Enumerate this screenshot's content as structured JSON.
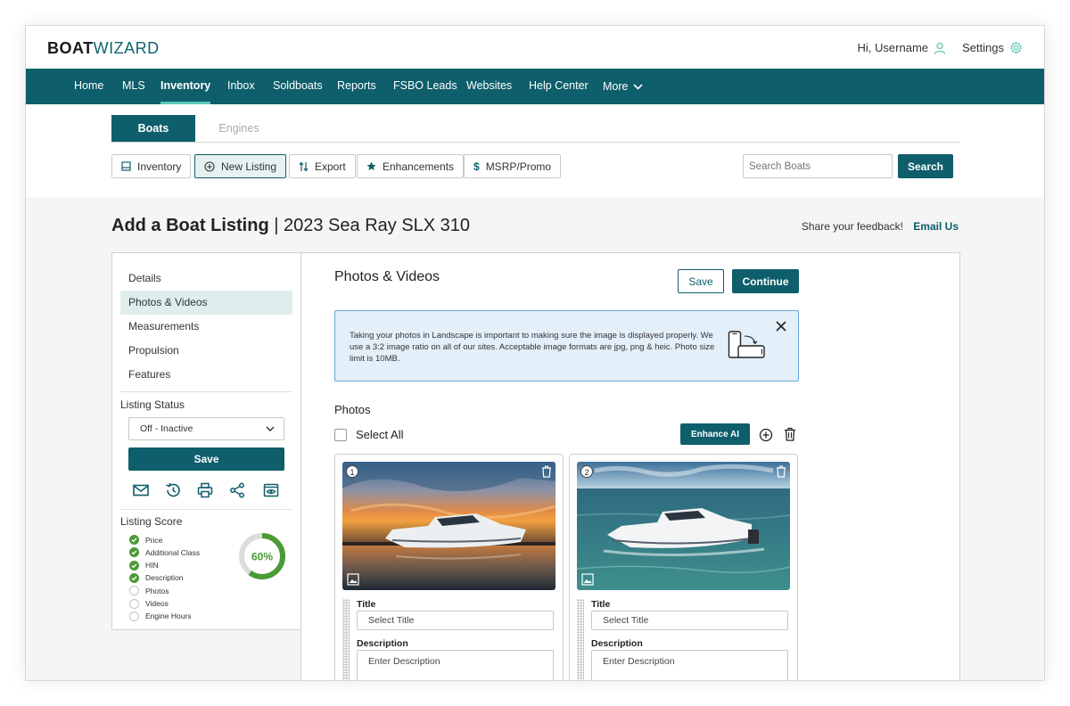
{
  "app": {
    "logo_bold": "BOAT",
    "logo_light": "WIZARD",
    "greeting": "Hi, Username",
    "settings_label": "Settings"
  },
  "nav": {
    "items": [
      "Home",
      "MLS",
      "Inventory",
      "Inbox",
      "Soldboats",
      "Reports",
      "FSBO Leads",
      "Websites",
      "Help Center",
      "More"
    ],
    "active": "Inventory"
  },
  "tabs": {
    "boats": "Boats",
    "engines": "Engines"
  },
  "toolbar": {
    "inventory": "Inventory",
    "new_listing": "New Listing",
    "export": "Export",
    "enhancements": "Enhancements",
    "msrp": "MSRP/Promo",
    "msrp_symbol": "$",
    "search_placeholder": "Search Boats",
    "search_button": "Search"
  },
  "page": {
    "title": "Add a Boat Listing",
    "separator": "|",
    "subtitle": "2023 Sea Ray SLX 310",
    "feedback_text": "Share your feedback!",
    "feedback_link": "Email Us"
  },
  "sidebar": {
    "items": [
      "Details",
      "Photos & Videos",
      "Measurements",
      "Propulsion",
      "Features"
    ],
    "selected": "Photos & Videos",
    "status_label": "Listing Status",
    "status_value": "Off - Inactive",
    "save_label": "Save",
    "score_label": "Listing Score",
    "score_items": [
      {
        "label": "Price",
        "done": true
      },
      {
        "label": "Additional Class",
        "done": true
      },
      {
        "label": "HIN",
        "done": true
      },
      {
        "label": "Description",
        "done": true
      },
      {
        "label": "Photos",
        "done": false
      },
      {
        "label": "Videos",
        "done": false
      },
      {
        "label": "Engine Hours",
        "done": false
      }
    ],
    "score_value": "60%",
    "score_fraction": 0.6
  },
  "main": {
    "section_title": "Photos & Videos",
    "save_label": "Save",
    "continue_label": "Continue",
    "info_text": "Taking your photos in Landscape is important to making sure the image is displayed properly. We use a 3:2 image ratio on all of our sites. Acceptable image formats are jpg, png & heic. Photo size limit is 10MB.",
    "photos_title": "Photos",
    "select_all": "Select All",
    "enhance_label": "Enhance AI",
    "cards": [
      {
        "number": "1",
        "title_label": "Title",
        "title_placeholder": "Select Title",
        "desc_label": "Description",
        "desc_placeholder": "Enter Description"
      },
      {
        "number": "2",
        "title_label": "Title",
        "title_placeholder": "Select Title",
        "desc_label": "Description",
        "desc_placeholder": "Enter Description"
      }
    ]
  },
  "colors": {
    "brand": "#0e5e6b",
    "accent": "#5fc7b7",
    "success": "#4a9a35",
    "info_bg": "#e3eff9"
  }
}
